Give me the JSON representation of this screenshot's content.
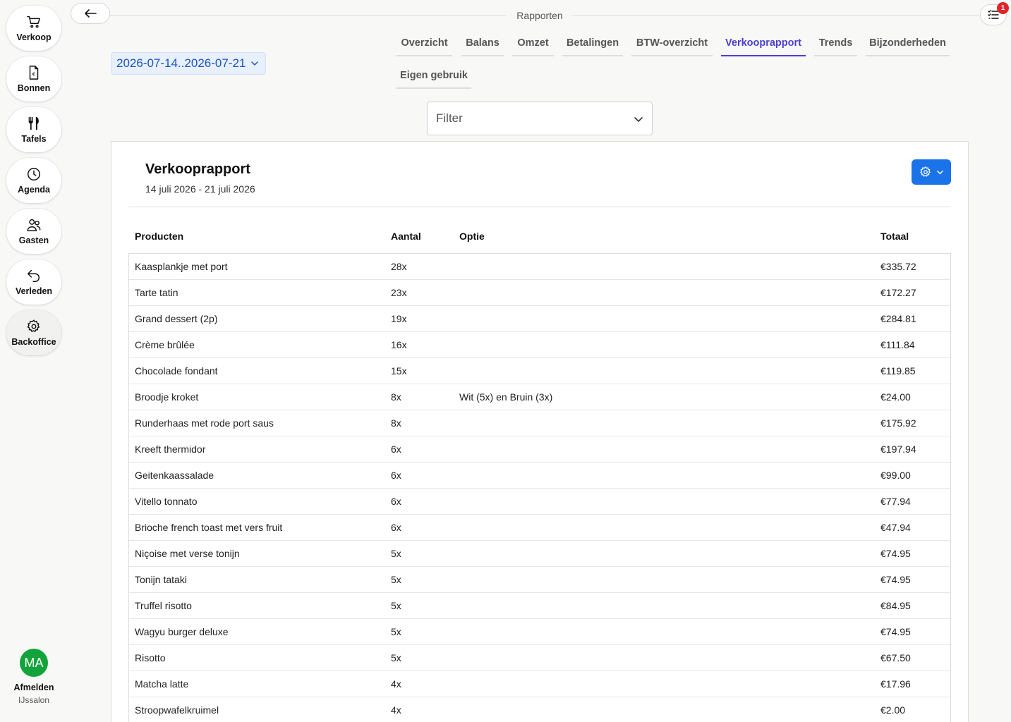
{
  "sidebar": {
    "items": [
      {
        "label": "Verkoop",
        "icon": "cart-icon"
      },
      {
        "label": "Bonnen",
        "icon": "receipt-icon"
      },
      {
        "label": "Tafels",
        "icon": "cutlery-icon"
      },
      {
        "label": "Agenda",
        "icon": "clock-icon"
      },
      {
        "label": "Gasten",
        "icon": "users-icon"
      },
      {
        "label": "Verleden",
        "icon": "undo-icon"
      },
      {
        "label": "Backoffice",
        "icon": "gear-icon"
      }
    ],
    "active": "Backoffice",
    "user": {
      "initials": "MA",
      "signout_label": "Afmelden",
      "org": "IJssalon",
      "avatar_color": "#12a33a"
    }
  },
  "header": {
    "title": "Rapporten",
    "notification_count": "1"
  },
  "date_range": "2026-07-14..2026-07-21",
  "tabs": [
    {
      "label": "Overzicht"
    },
    {
      "label": "Balans"
    },
    {
      "label": "Omzet"
    },
    {
      "label": "Betalingen"
    },
    {
      "label": "BTW-overzicht"
    },
    {
      "label": "Verkooprapport"
    },
    {
      "label": "Trends"
    },
    {
      "label": "Bijzonderheden"
    },
    {
      "label": "Eigen gebruik"
    }
  ],
  "active_tab": "Verkooprapport",
  "filter": {
    "placeholder": "Filter"
  },
  "report": {
    "title": "Verkooprapport",
    "subtitle": "14 juli 2026 - 21 juli 2026",
    "columns": {
      "product": "Producten",
      "quantity": "Aantal",
      "option": "Optie",
      "total": "Totaal"
    },
    "rows": [
      {
        "product": "Kaasplankje met port",
        "quantity": "28x",
        "option": "",
        "total": "€335.72"
      },
      {
        "product": "Tarte tatin",
        "quantity": "23x",
        "option": "",
        "total": "€172.27"
      },
      {
        "product": "Grand dessert (2p)",
        "quantity": "19x",
        "option": "",
        "total": "€284.81"
      },
      {
        "product": "Crème brûlée",
        "quantity": "16x",
        "option": "",
        "total": "€111.84"
      },
      {
        "product": "Chocolade fondant",
        "quantity": "15x",
        "option": "",
        "total": "€119.85"
      },
      {
        "product": "Broodje kroket",
        "quantity": "8x",
        "option": "Wit (5x) en Bruin (3x)",
        "total": "€24.00"
      },
      {
        "product": "Runderhaas met rode port saus",
        "quantity": "8x",
        "option": "",
        "total": "€175.92"
      },
      {
        "product": "Kreeft thermidor",
        "quantity": "6x",
        "option": "",
        "total": "€197.94"
      },
      {
        "product": "Geitenkaassalade",
        "quantity": "6x",
        "option": "",
        "total": "€99.00"
      },
      {
        "product": "Vitello tonnato",
        "quantity": "6x",
        "option": "",
        "total": "€77.94"
      },
      {
        "product": "Brioche french toast met vers fruit",
        "quantity": "6x",
        "option": "",
        "total": "€47.94"
      },
      {
        "product": "Niçoise met verse tonijn",
        "quantity": "5x",
        "option": "",
        "total": "€74.95"
      },
      {
        "product": "Tonijn tataki",
        "quantity": "5x",
        "option": "",
        "total": "€74.95"
      },
      {
        "product": "Truffel risotto",
        "quantity": "5x",
        "option": "",
        "total": "€84.95"
      },
      {
        "product": "Wagyu burger deluxe",
        "quantity": "5x",
        "option": "",
        "total": "€74.95"
      },
      {
        "product": "Risotto",
        "quantity": "5x",
        "option": "",
        "total": "€67.50"
      },
      {
        "product": "Matcha latte",
        "quantity": "4x",
        "option": "",
        "total": "€17.96"
      },
      {
        "product": "Stroopwafelkruimel",
        "quantity": "4x",
        "option": "",
        "total": "€2.00"
      }
    ]
  },
  "colors": {
    "accent": "#4b3fd0",
    "primary_button": "#1a73e8",
    "date_text": "#1b55c5",
    "badge": "#e0242b"
  }
}
